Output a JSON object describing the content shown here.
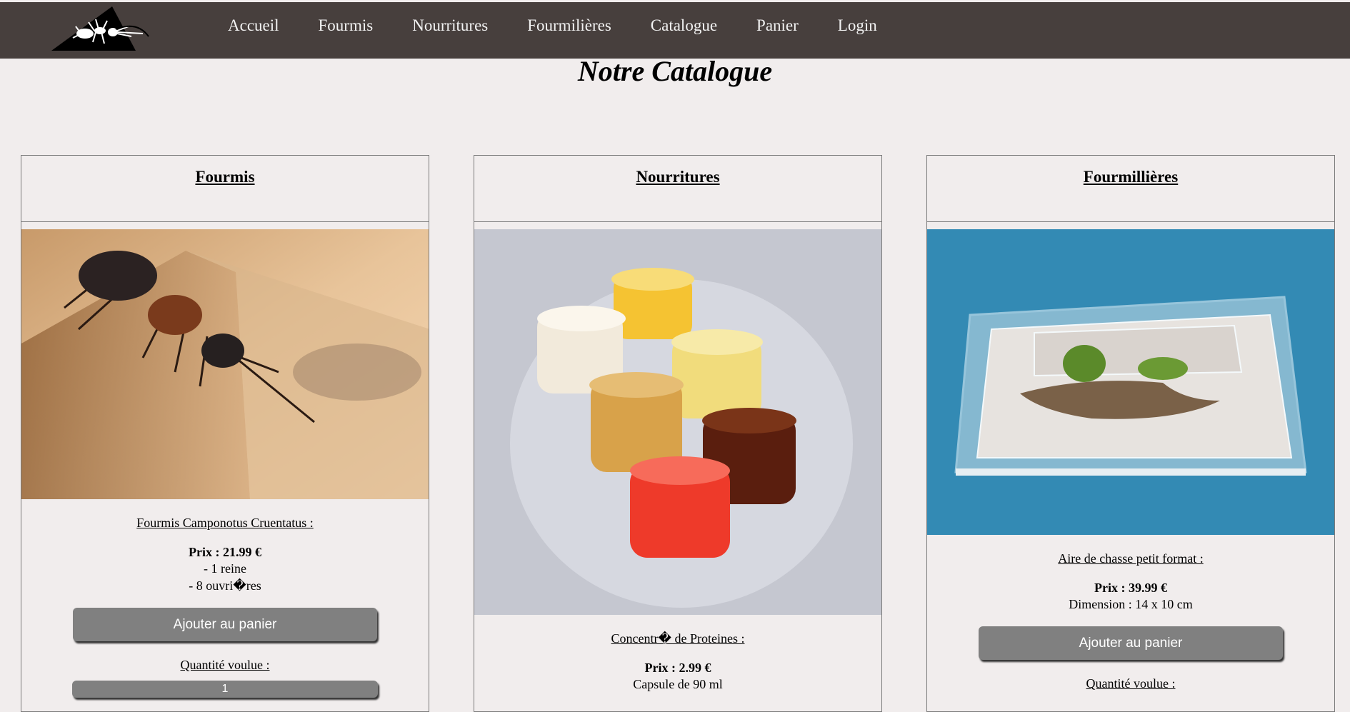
{
  "nav": {
    "logo": "ant-logo",
    "items": [
      "Accueil",
      "Fourmis",
      "Nourritures",
      "Fourmilières",
      "Catalogue",
      "Panier",
      "Login"
    ]
  },
  "page_title": "Notre Catalogue",
  "cards": [
    {
      "category": "Fourmis",
      "image": "ant-photo",
      "product_name": "Fourmis Camponotus Cruentatus :",
      "price": "Prix : 21.99 €",
      "desc": [
        "- 1 reine",
        "- 8 ouvri�res"
      ],
      "button": "Ajouter au panier",
      "qty_label": "Quantité voulue :",
      "qty_value": "1"
    },
    {
      "category": "Nourritures",
      "image": "protein-jelly-cups-photo",
      "product_name": "Concentr� de Proteines :",
      "price": "Prix : 2.99 €",
      "desc": [
        "Capsule de 90 ml"
      ]
    },
    {
      "category": "Fourmillières",
      "image": "acrylic-formicarium-photo",
      "product_name": "Aire de chasse petit format :",
      "price": "Prix : 39.99 €",
      "desc": [
        "Dimension : 14 x 10 cm"
      ],
      "button": "Ajouter au panier",
      "qty_label": "Quantité voulue :"
    }
  ],
  "colors": {
    "topbar": "#473f3d",
    "background": "#f1eded",
    "button": "#808080"
  }
}
